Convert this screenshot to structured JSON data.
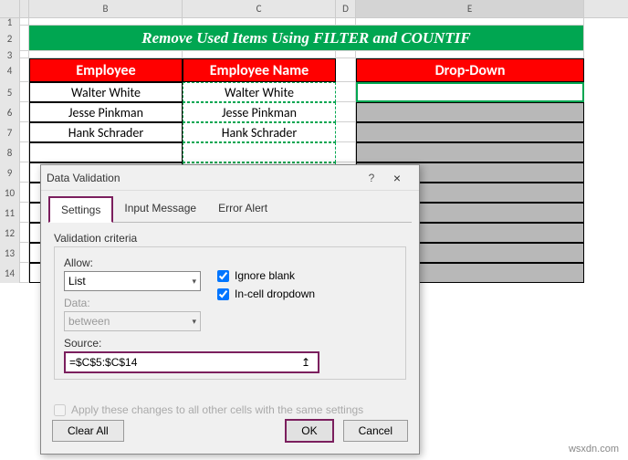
{
  "columns": [
    "B",
    "C",
    "D",
    "E"
  ],
  "title": "Remove Used Items Using FILTER and COUNTIF",
  "headers": {
    "employee": "Employee",
    "employee_name": "Employee Name",
    "dropdown": "Drop-Down"
  },
  "employees": [
    "Walter White",
    "Jesse Pinkman",
    "Hank Schrader"
  ],
  "dialog": {
    "title": "Data Validation",
    "help": "?",
    "close": "×",
    "tabs": {
      "settings": "Settings",
      "input_msg": "Input Message",
      "error_alert": "Error Alert"
    },
    "criteria_label": "Validation criteria",
    "allow_label": "Allow:",
    "allow_value": "List",
    "data_label": "Data:",
    "data_value": "between",
    "ignore_blank": "Ignore blank",
    "incell": "In-cell dropdown",
    "source_label": "Source:",
    "source_value": "=$C$5:$C$14",
    "apply": "Apply these changes to all other cells with the same settings",
    "clear": "Clear All",
    "ok": "OK",
    "cancel": "Cancel",
    "src_icon": "↥"
  },
  "watermark": "wsxdn.com"
}
